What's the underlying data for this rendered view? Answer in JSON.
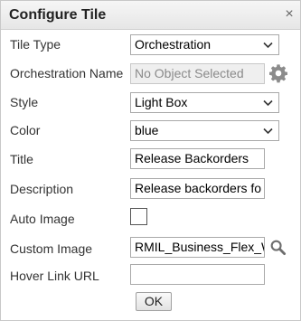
{
  "dialog": {
    "title": "Configure Tile",
    "close_label": "×"
  },
  "fields": {
    "tile_type": {
      "label": "Tile Type",
      "value": "Orchestration"
    },
    "orchestration_name": {
      "label": "Orchestration Name",
      "placeholder": "No Object Selected",
      "icon": "gear-icon"
    },
    "style": {
      "label": "Style",
      "value": "Light Box"
    },
    "color": {
      "label": "Color",
      "value": "blue"
    },
    "title": {
      "label": "Title",
      "value": "Release Backorders"
    },
    "description": {
      "label": "Description",
      "value": "Release backorders fo"
    },
    "auto_image": {
      "label": "Auto Image",
      "checked": false
    },
    "custom_image": {
      "label": "Custom Image",
      "value": "RMIL_Business_Flex_W",
      "icon": "search-icon"
    },
    "hover_link_url": {
      "label": "Hover Link URL",
      "value": ""
    }
  },
  "buttons": {
    "ok_label": "OK"
  }
}
